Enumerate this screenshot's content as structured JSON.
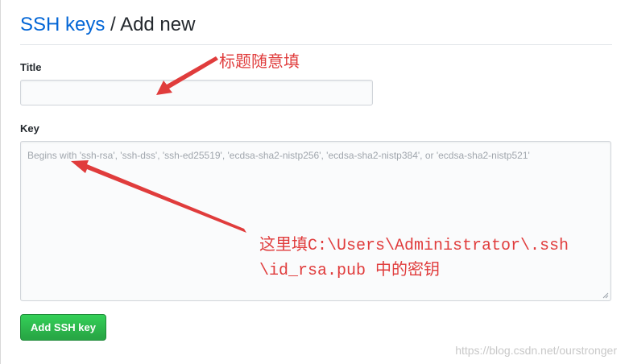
{
  "header": {
    "breadcrumb_link": "SSH keys",
    "separator": "/",
    "current_page": "Add new"
  },
  "form": {
    "title_label": "Title",
    "title_value": "",
    "key_label": "Key",
    "key_placeholder": "Begins with 'ssh-rsa', 'ssh-dss', 'ssh-ed25519', 'ecdsa-sha2-nistp256', 'ecdsa-sha2-nistp384', or 'ecdsa-sha2-nistp521'",
    "submit_label": "Add SSH key"
  },
  "annotations": {
    "title_note": "标题随意填",
    "key_note_line1": "这里填C:\\Users\\Administrator\\.ssh",
    "key_note_line2": "\\id_rsa.pub 中的密钥"
  },
  "watermark": "https://blog.csdn.net/ourstronger",
  "colors": {
    "link": "#0366d6",
    "button_green": "#28a745",
    "annotation_red": "#e03c3c"
  }
}
